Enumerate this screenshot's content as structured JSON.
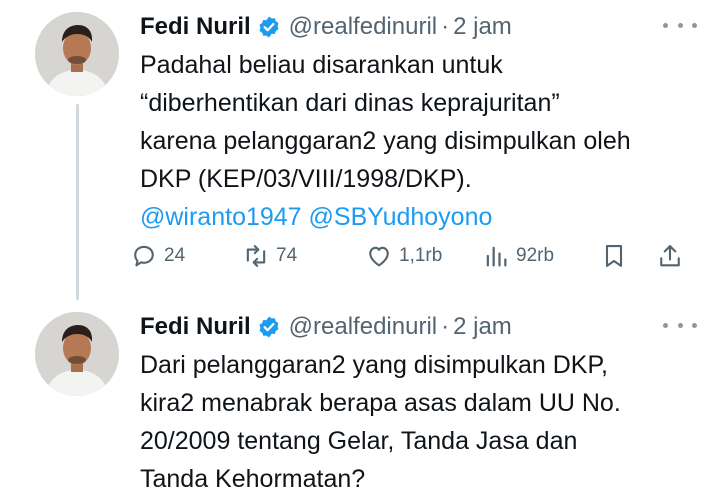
{
  "tweets": [
    {
      "display_name": "Fedi Nuril",
      "handle": "@realfedinuril",
      "separator": "·",
      "time": "2 jam",
      "lines": [
        "Padahal beliau disarankan untuk",
        "“diberhentikan dari dinas keprajuritan”",
        "karena pelanggaran2 yang disimpulkan oleh",
        "DKP (KEP/03/VIII/1998/DKP)."
      ],
      "mentions": [
        "@wiranto1947",
        "@SBYudhoyono"
      ],
      "stats": {
        "replies": "24",
        "retweets": "74",
        "likes": "1,1rb",
        "views": "92rb"
      }
    },
    {
      "display_name": "Fedi Nuril",
      "handle": "@realfedinuril",
      "separator": "·",
      "time": "2 jam",
      "lines": [
        "Dari pelanggaran2 yang disimpulkan DKP,",
        "kira2 menabrak berapa asas dalam UU No.",
        "20/2009 tentang Gelar, Tanda Jasa dan",
        "Tanda Kehormatan?"
      ]
    }
  ],
  "icons": {
    "reply": "reply-icon",
    "retweet": "retweet-icon",
    "like": "heart-icon",
    "views": "views-icon",
    "bookmark": "bookmark-icon",
    "share": "share-icon",
    "verified": "verified-badge-icon",
    "more": "more-icon"
  },
  "colors": {
    "text": "#0f1419",
    "secondary": "#536471",
    "link": "#1d9bf0",
    "verified": "#1d9bf0",
    "thread_line": "#cfd9de"
  }
}
